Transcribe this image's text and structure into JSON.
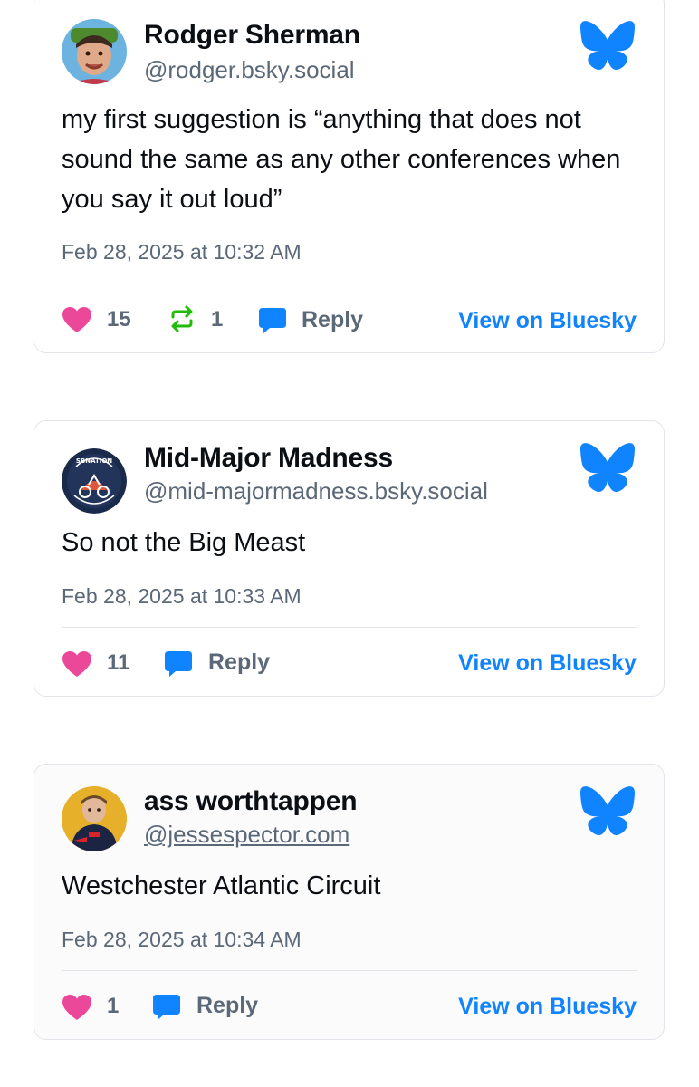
{
  "colors": {
    "like": "#ec4899",
    "repost": "#20bc07",
    "reply": "#1083fe",
    "link": "#1083fe",
    "muted": "#5b6878"
  },
  "posts": [
    {
      "author_name": "Rodger Sherman",
      "handle": "@rodger.bsky.social",
      "text": "my first suggestion is “anything that does not sound the same as any other conferences when you say it out loud”",
      "timestamp": "Feb 28, 2025 at 10:32 AM",
      "likes": "15",
      "reposts": "1",
      "reply_label": "Reply",
      "view_label": "View on Bluesky",
      "avatar_icon": "avatar-photo",
      "logo_icon": "bluesky-butterfly-icon"
    },
    {
      "author_name": "Mid-Major Madness",
      "handle": "@mid-majormadness.bsky.social",
      "text": "So not the Big Meast",
      "timestamp": "Feb 28, 2025 at 10:33 AM",
      "likes": "11",
      "reply_label": "Reply",
      "view_label": "View on Bluesky",
      "avatar_icon": "sbnation-logo",
      "avatar_logo_text": "SBNATION",
      "logo_icon": "bluesky-butterfly-icon"
    },
    {
      "author_name": "ass worthtappen",
      "handle": "@jessespector.com",
      "text": "Westchester Atlantic Circuit",
      "timestamp": "Feb 28, 2025 at 10:34 AM",
      "likes": "1",
      "reply_label": "Reply",
      "view_label": "View on Bluesky",
      "avatar_icon": "avatar-photo",
      "logo_icon": "bluesky-butterfly-icon"
    }
  ]
}
